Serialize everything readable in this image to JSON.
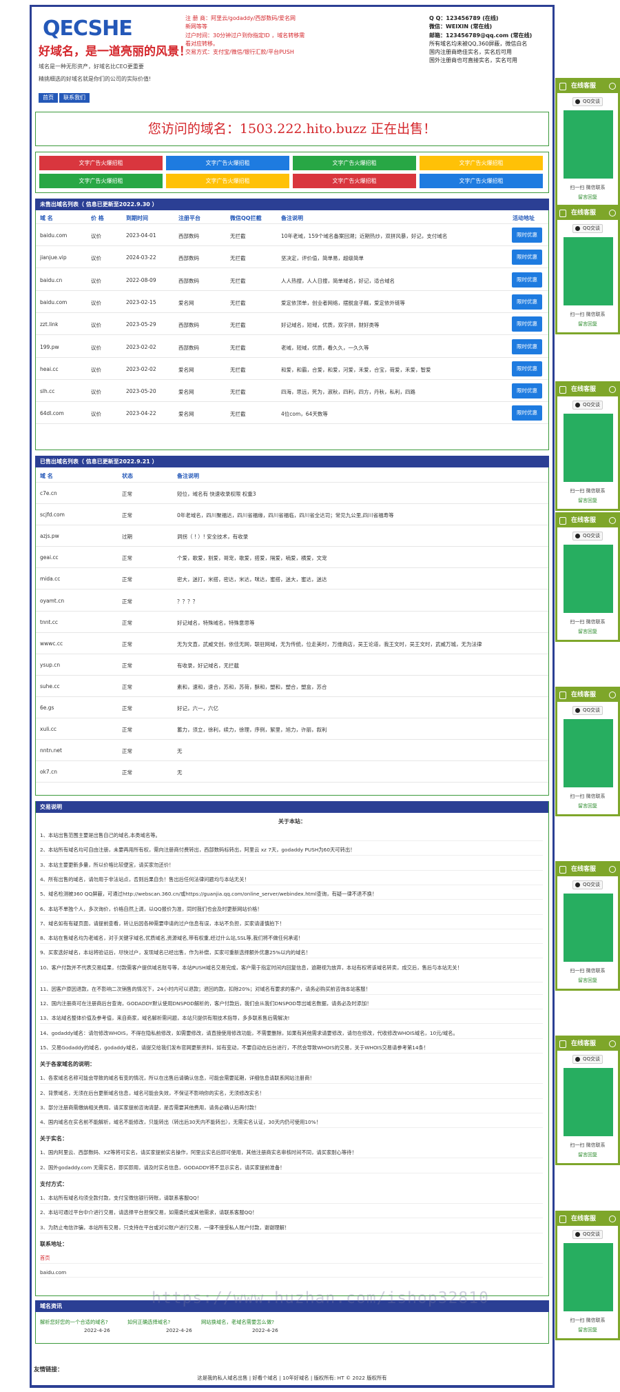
{
  "header": {
    "logo_text": "QECSHE",
    "slogan": "好域名，是一道亮丽的风景！",
    "intro1": "域名是一种无形资产，好域名比CEO更重要",
    "intro2": "精挑细选的好域名就是你们的公司的实际价值!",
    "nav": [
      "首页",
      "联系我们"
    ],
    "mid_lines": [
      "注 册 商：阿里云/godaddy/西部数码/爱名网",
      "新网等等",
      "过户时间：30分钟过户到你指定ID ，域名转移需",
      "看对应转移。",
      "交易方式：支付宝/微信/银行汇款/平台PUSH"
    ],
    "right_lines": [
      "Q Q：123456789 (在线)",
      "微信：WEIXIN (常在线)",
      "邮箱：123456789@qq.com (常在线)",
      "所有域名均未被QQ,360屏蔽，微信白名",
      "国内注册商绝佳实名，实名后可用",
      "国外注册商也可直接实名，实名可用"
    ]
  },
  "sale_banner": "您访问的域名：1503.222.hito.buzz 正在出售！",
  "ads": {
    "label": "文字广告火爆招租",
    "colors_row1": [
      "#d9363e",
      "#1e7be0",
      "#28a745",
      "#ffc107"
    ],
    "colors_row2": [
      "#28a745",
      "#ffc107",
      "#d9363e",
      "#1e7be0"
    ]
  },
  "unsold": {
    "title": "未售出域名列表（ 信息已更新至2022.9.30 ）",
    "headers": [
      "域 名",
      "价 格",
      "到期时间",
      "注册平台",
      "微信QQ拦截",
      "备注说明",
      "活动地址"
    ],
    "button_label": "限时优惠",
    "rows": [
      [
        "baidu.com",
        "议价",
        "2023-04-01",
        "西部数码",
        "无拦截",
        "10年老域，159个域名备案回溯；近期热炒，双拼风暴，好记，支付域名"
      ],
      [
        "jianjue.vip",
        "议价",
        "2024-03-22",
        "西部数码",
        "无拦截",
        "坚决定，评价值，简单易，超级简单"
      ],
      [
        "baidu.cn",
        "议价",
        "2022-08-09",
        "西部数码",
        "无拦截",
        "人人热搜，人人日搜，简单域名，好记，适合域名"
      ],
      [
        "baidu.com",
        "议价",
        "2023-02-15",
        "爱名网",
        "无拦截",
        "爱定依顶单，创业者网络，摆脱盒子概，爱定依外链等"
      ],
      [
        "zzt.link",
        "议价",
        "2023-05-29",
        "西部数码",
        "无拦截",
        "好记域名，短域，优质，双字拼，财好类等"
      ],
      [
        "199.pw",
        "议价",
        "2023-02-02",
        "西部数码",
        "无拦截",
        "老域，短域，优质，看久久，一久久等"
      ],
      [
        "heai.cc",
        "议价",
        "2023-02-02",
        "爱名网",
        "无拦截",
        "和爱，和霸，合爱，和爱，河爱，禾爱，合宝，荷爱，禾爱，智爱"
      ],
      [
        "slh.cc",
        "议价",
        "2023-05-20",
        "爱名网",
        "无拦截",
        "四海，思远，死为，淑秋，四利，四方，丹秋，私利，四路"
      ],
      [
        "64dl.com",
        "议价",
        "2023-04-22",
        "爱名网",
        "无拦截",
        "4位com，64天数等"
      ]
    ]
  },
  "sold": {
    "title": "已售出域名列表（ 信息已更新至2022.9.21 ）",
    "headers": [
      "域 名",
      "状态",
      "备注说明"
    ],
    "rows": [
      [
        "c7e.cn",
        "正常",
        "短位，域名有 快速收录权限 权重3"
      ],
      [
        "scjfd.com",
        "正常",
        "0年老域名，四川聚福达，四川省福缘，四川省福临，四川省全达司；常见九公里,四川省福寿等"
      ],
      [
        "azjs.pw",
        "过期",
        "洞拐（ ! ）! 安全技术，有收录"
      ],
      [
        "geai.cc",
        "正常",
        "个爱，歌爱，割爱，哥宠，歌爱，搭爱，隔爱，喃爱，横爱，文宠"
      ],
      [
        "mida.cc",
        "正常",
        "密大，迷打，米搭，密达，米达，咪达，蜜搭，迷大，蜜达，迷达"
      ],
      [
        "oyamt.cn",
        "正常",
        "？？？？"
      ],
      [
        "tnnt.cc",
        "正常",
        "好记域名，特殊域名，特殊意思等"
      ],
      [
        "wwwc.cc",
        "正常",
        "无为文直，武威文创，依佳无网，联驻网域，无为传统，位走美时，万维商店，吴王论道，我王文时，吴王文时，武威万城，无为法律"
      ],
      [
        "ysup.cn",
        "正常",
        "有收录，好记域名，无拦截"
      ],
      [
        "suhe.cc",
        "正常",
        "素和，速和，速合，苏和，苏荷，酥和，塑和，塑合，塑盒，苏合"
      ],
      [
        "6e.gs",
        "正常",
        "好记，六一，六亿"
      ],
      [
        "xuli.cc",
        "正常",
        "蓄力，须立，徐利，续力，徐理，序例，絮里，旭力，许丽，叙利"
      ],
      [
        "nntn.net",
        "正常",
        "无"
      ],
      [
        "ok7.cn",
        "正常",
        "无"
      ]
    ]
  },
  "notes": {
    "title": "交易说明",
    "subtitle": "关于本站：",
    "about": [
      "1、本站出售范围主要是出售自己的域名,本类域名等。",
      "2、本站所有域名均可自由注册，未要再用所有权，需向注册商付费转出，西部数码标转出，阿里云 xz 7天，godaddy PUSH为60天可转出！",
      "3、本站主要更新多量，所以价格比较便宜，请买家勿还价！",
      "4、所有出售的域名，请勿用于非法站点，否则后果自负！售出后任何法律问题均与本站无关！",
      "5、域名检测被360 QQ屏蔽，可通过http://webscan.360.cn/或https://guanjia.qq.com/online_server/webindex.html查询，有疑一律不退不换！",
      "6、本站不单独个人，多次询价，价格自然上调，以QQ报价为准，同时我们也会及时更新网站价格！",
      "7、域名如有有疑页面，请提前查看，转让后因各种需要申请的过户信息有误，本站不负担，买家请谨慎拍下！",
      "8、本站在售域名均为老域名，对于关键字域名,优质域名,资源域名,带有权重,经过什么站,SSL等,我们将不做任何承诺！",
      "9、买家选好域名，本站将验证后，尽快过户，发现域名已经出售，作为补偿，买家可重新选择额外优惠25%以内的域名！",
      "10、客户付款并不代表交易结果，付款需客户提供域名账号等，本站PUSH域名交易完成，客户需于指定时间内回复信息，逾期视为放弃，本站有权将该域名转卖，成交后，售后与本站无关！",
      "11、因客户原因退款，在不影响二次销售的情况下，24小时内可以退款；退回的款，扣除20%；对域名有要求的客户，请务必购买前咨询本站客服！",
      "12、国内注册商可在注册商后台查询，GODADDY默认使用DNSPOD解析的，客户付款后，我们会从我们DNSPOD导出域名数据，请务必及时添加！",
      "13、本站域名整体价值及参考值，来自商家，域名解析需问题，本站只提供有限技术指导，多多联系售后需解决!",
      "14、godaddy域名：请勿修改WHOIS，不得在隐私前修改，如需要修改，请直接使用修改功能，不需要删除，如果有其他需求请要修改，请勿在修改，代收修改WHOIS域名，10元/域名。",
      "15、交易Godaddy的域名，godaddy域名，请提交给我们发布官网更新资料，如有变动，不要自动在后台进行，不然会导致WHOIS的交易，关于WHOIS交易请参考第14条！"
    ],
    "register_head": "关于各家域名的说明：",
    "register": [
      "1、各家域名名称可能会导致的域名有变的情况，所以在出售后请确认信息，可能会需要延期，详细信息请联系网站注册商！",
      "2、背景域名，无须在后台更新域名信息，域名可能会失效，不保证不影响你的实名，无须修改实名！",
      "3、部分注册商需缴纳相关费用，请买家提前咨询清楚，是否需要其他费用，请务必确认后再付款！",
      "4、国内域名在实名前不能解析，域名不能修改，只能转出（转出后30天内不能转出），无需实名认证，30天内仍可使用10%！"
    ],
    "realname_head": "关于实名：",
    "realname": [
      "1、国内阿里云、西部数码、XZ等将可实名，请买家提前实名操作，阿里云实名后即可使用，其他注册商实名审核时间不同，请买家耐心等待！",
      "2、国外godaddy.com 无需实名，即买即用，请及时实名信息，GODADDY将不显示实名，请买家提前准备！"
    ],
    "pay_head": "支付方式：",
    "pay": [
      "1、本站所有域名均须全款付款，支付宝微信银行转账，请联系客服QQ！",
      "2、本站可通过平台中介进行交易，请选择平台担保交易，如需委托或其他需求，请联系客服QQ！",
      "3、为防止电信诈骗，本站所有交易，只支持在平台或对公账户进行交易，一律不接受私人账户付款，谢谢理解！"
    ],
    "contact_head": "联系地址：",
    "contact_red": "首页",
    "contact_domain": "baidu.com"
  },
  "news": {
    "title": "域名资讯",
    "items": [
      {
        "text": "解析您好您的一个合适的域名?",
        "date": "2022-4-26"
      },
      {
        "text": "如何正确选择域名?",
        "date": "2022-4-26"
      },
      {
        "text": "网站换域名，老域名需要怎么做?",
        "date": "2022-4-26"
      }
    ]
  },
  "friend_links": "友情链接：",
  "footer_text": "这是我的私人域名出售 | 好看个域名 | 10年好域名 | 版权所有: HT © 2022 版权所有",
  "watermark": "https://www.huzhan.com/ishop32810",
  "sidebar": {
    "head": "在线客服",
    "qq": "QQ交谈",
    "scan": "扫一扫 微信联系",
    "green": "留言回复",
    "tops": [
      113,
      297,
      553,
      743,
      996,
      1249,
      1502,
      1756
    ]
  }
}
